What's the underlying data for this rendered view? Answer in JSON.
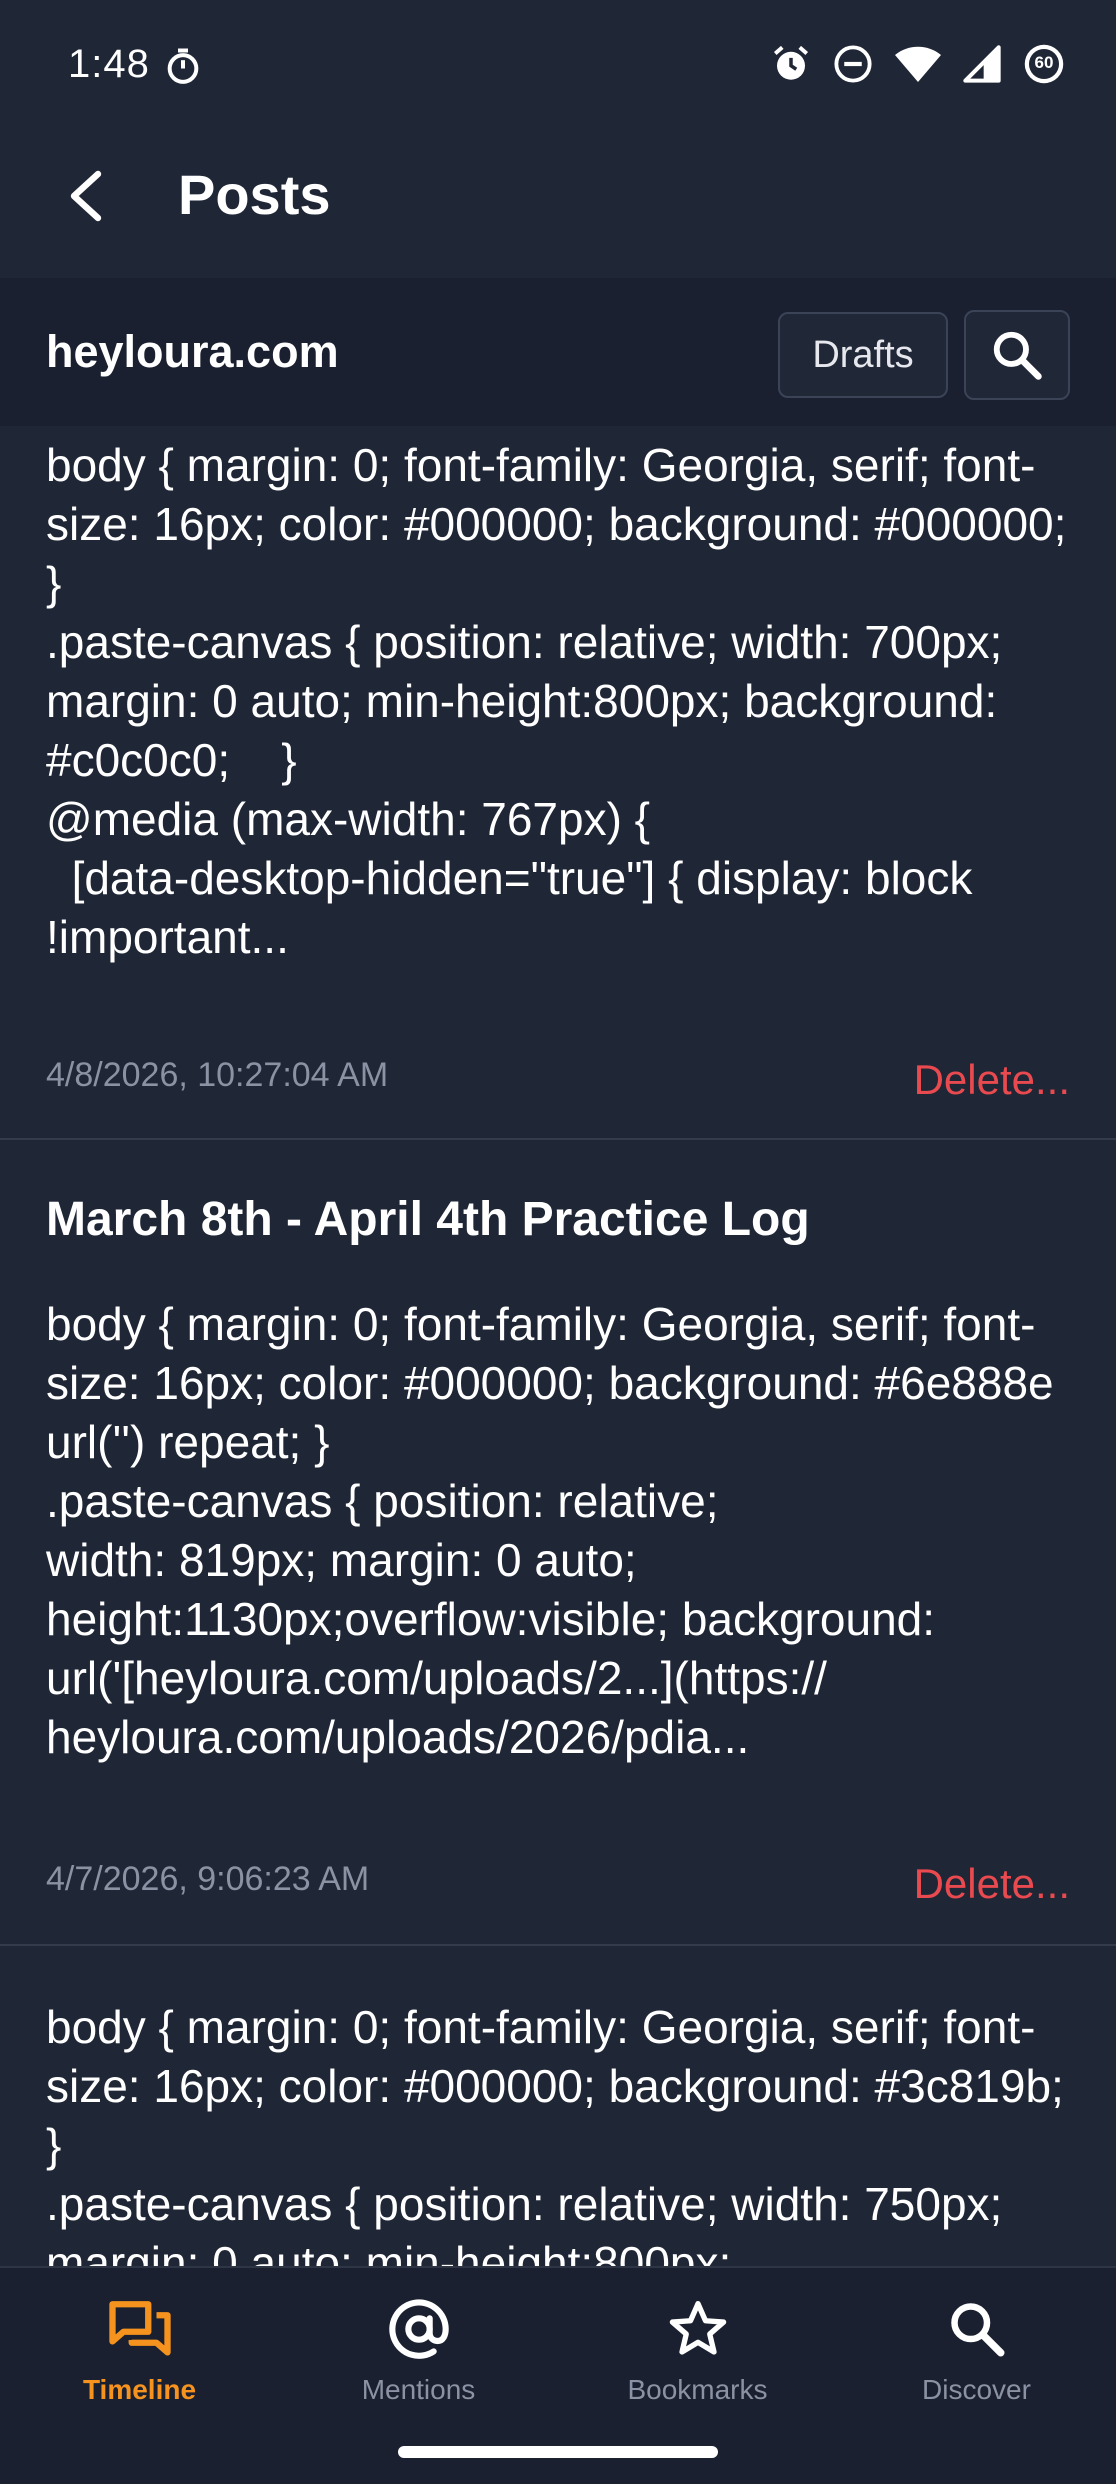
{
  "status_bar": {
    "time": "1:48",
    "battery_level": "60"
  },
  "app_bar": {
    "title": "Posts"
  },
  "site_bar": {
    "site_name": "heyloura.com",
    "drafts_label": "Drafts"
  },
  "posts": [
    {
      "title": "",
      "body": "body { margin: 0; font-family: Georgia, serif; font-size: 16px; color: #000000; background: #000000; }\n.paste-canvas { position: relative; width: 700px; margin: 0 auto; min-height:800px; background: #c0c0c0;    }\n@media (max-width: 767px) {\n  [data-desktop-hidden=\"true\"] { display: block !important...",
      "date": "4/8/2026, 10:27:04 AM",
      "delete_label": "Delete..."
    },
    {
      "title": "March 8th - April 4th Practice Log",
      "body": "body { margin: 0; font-family: Georgia, serif; font-size: 16px; color: #000000; background: #6e888e url('') repeat; }\n.paste-canvas { position: relative;\nwidth: 819px; margin: 0 auto;\nheight:1130px;overflow:visible; background: url('[heyloura.com/uploads/2...](https://\nheyloura.com/uploads/2026/pdia...",
      "date": "4/7/2026, 9:06:23 AM",
      "delete_label": "Delete..."
    },
    {
      "title": "",
      "body": "body { margin: 0; font-family: Georgia, serif; font-size: 16px; color: #000000; background: #3c819b; }\n.paste-canvas { position: relative; width: 750px; margin: 0 auto; min-height:800px;",
      "date": "",
      "delete_label": ""
    }
  ],
  "bottom_nav": {
    "items": [
      {
        "label": "Timeline",
        "icon": "timeline-icon",
        "active": true
      },
      {
        "label": "Mentions",
        "icon": "at-sign-icon",
        "active": false
      },
      {
        "label": "Bookmarks",
        "icon": "star-icon",
        "active": false
      },
      {
        "label": "Discover",
        "icon": "search-icon",
        "active": false
      }
    ]
  },
  "colors": {
    "background": "#1f2635",
    "accent": "#f5931e",
    "delete": "#e84a4f"
  }
}
